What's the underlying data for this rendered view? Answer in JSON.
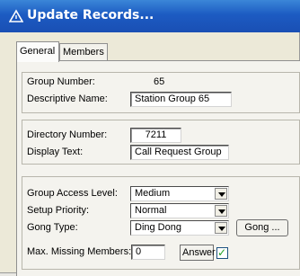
{
  "window": {
    "title": "Update Records..."
  },
  "tabs": [
    {
      "label": "General",
      "active": true
    },
    {
      "label": "Members",
      "active": false
    }
  ],
  "group_info": {
    "group_number_label": "Group Number:",
    "group_number_value": "65",
    "descriptive_name_label": "Descriptive Name:",
    "descriptive_name_value": "Station Group 65"
  },
  "directory": {
    "directory_number_label": "Directory Number:",
    "directory_number_value": "7211",
    "display_text_label": "Display Text:",
    "display_text_value": "Call Request Group"
  },
  "settings": {
    "access_level_label": "Group Access Level:",
    "access_level_value": "Medium",
    "setup_priority_label": "Setup Priority:",
    "setup_priority_value": "Normal",
    "gong_type_label": "Gong Type:",
    "gong_type_value": "Ding Dong",
    "gong_button_label": "Gong ...",
    "max_missing_label": "Max. Missing Members:",
    "max_missing_value": "0",
    "answer_label": "Answer",
    "answer_checked": true
  },
  "colors": {
    "titlebar": "#1c5bc2",
    "window_bg": "#ece9d8",
    "check": "#21a121"
  }
}
